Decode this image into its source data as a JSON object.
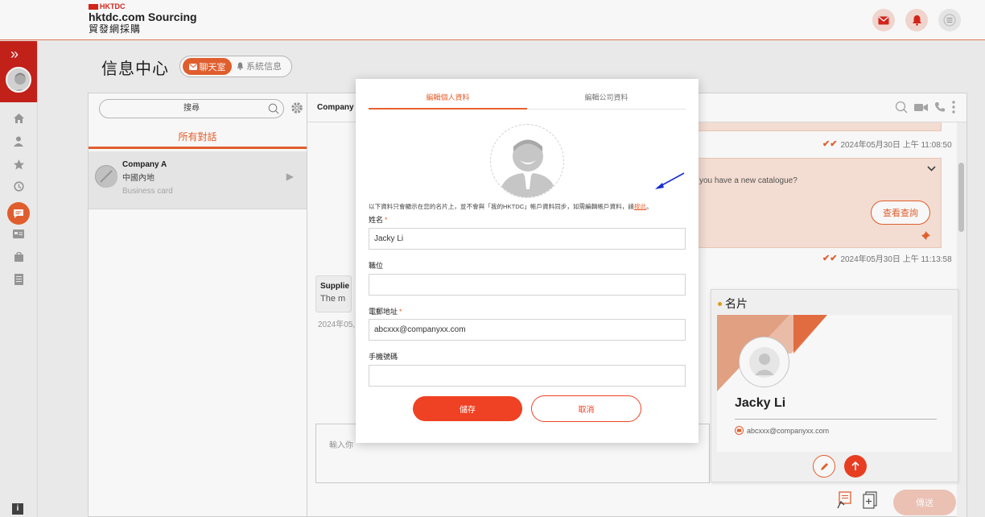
{
  "header": {
    "logo_mark": "HKTDC",
    "logo_title": "hktdc.com Sourcing",
    "logo_subtitle": "貿發網採購",
    "icons": [
      "mail-icon",
      "bell-icon",
      "menu-icon"
    ],
    "accent_color": "#e8622f",
    "brand_color": "#c9231b"
  },
  "sidebar": {
    "expand_label": "»",
    "items": [
      "home-icon",
      "user-icon",
      "star-icon",
      "history-icon",
      "chat-icon",
      "card-icon",
      "bag-icon",
      "document-icon"
    ],
    "info_label": "i"
  },
  "page": {
    "title": "信息中心",
    "segment_chat": "聊天室",
    "segment_system": "系統信息"
  },
  "conversations": {
    "search_placeholder": "搜尋",
    "tab_all": "所有對話",
    "items": [
      {
        "name": "Company A",
        "region": "中國內地",
        "subtitle": "Business card"
      }
    ]
  },
  "chat": {
    "header_name": "Company A",
    "timestamps": [
      "2024年05月30日 上午 11:08:50",
      "2024年05月30日 上午 11:13:58"
    ],
    "bubble_text": "you have a new catalogue?",
    "query_button": "查看查詢",
    "incoming_name": "Supplie",
    "incoming_text": "The m",
    "incoming_ts": "2024年05,",
    "input_placeholder": "輸入你",
    "send_label": "傳送"
  },
  "business_card": {
    "title": "名片",
    "name": "Jacky Li",
    "email": "abcxxx@companyxx.com"
  },
  "modal": {
    "tab_personal": "編輯個人資料",
    "tab_company": "編輯公司資料",
    "notice_text": "以下資料只會顯示在您的名片上，並不會與「我的HKTDC」帳戶資料同步，如需編輯帳戶資料，請",
    "notice_link": "按此",
    "notice_end": "。",
    "fields": [
      {
        "label": "姓名",
        "required": "*",
        "value": "Jacky  Li"
      },
      {
        "label": "職位",
        "required": "",
        "value": ""
      },
      {
        "label": "電郵地址",
        "required": "*",
        "value": "abcxxx@companyxx.com"
      },
      {
        "label": "手機號碼",
        "required": "",
        "value": ""
      }
    ],
    "save_label": "儲存",
    "cancel_label": "取消"
  }
}
